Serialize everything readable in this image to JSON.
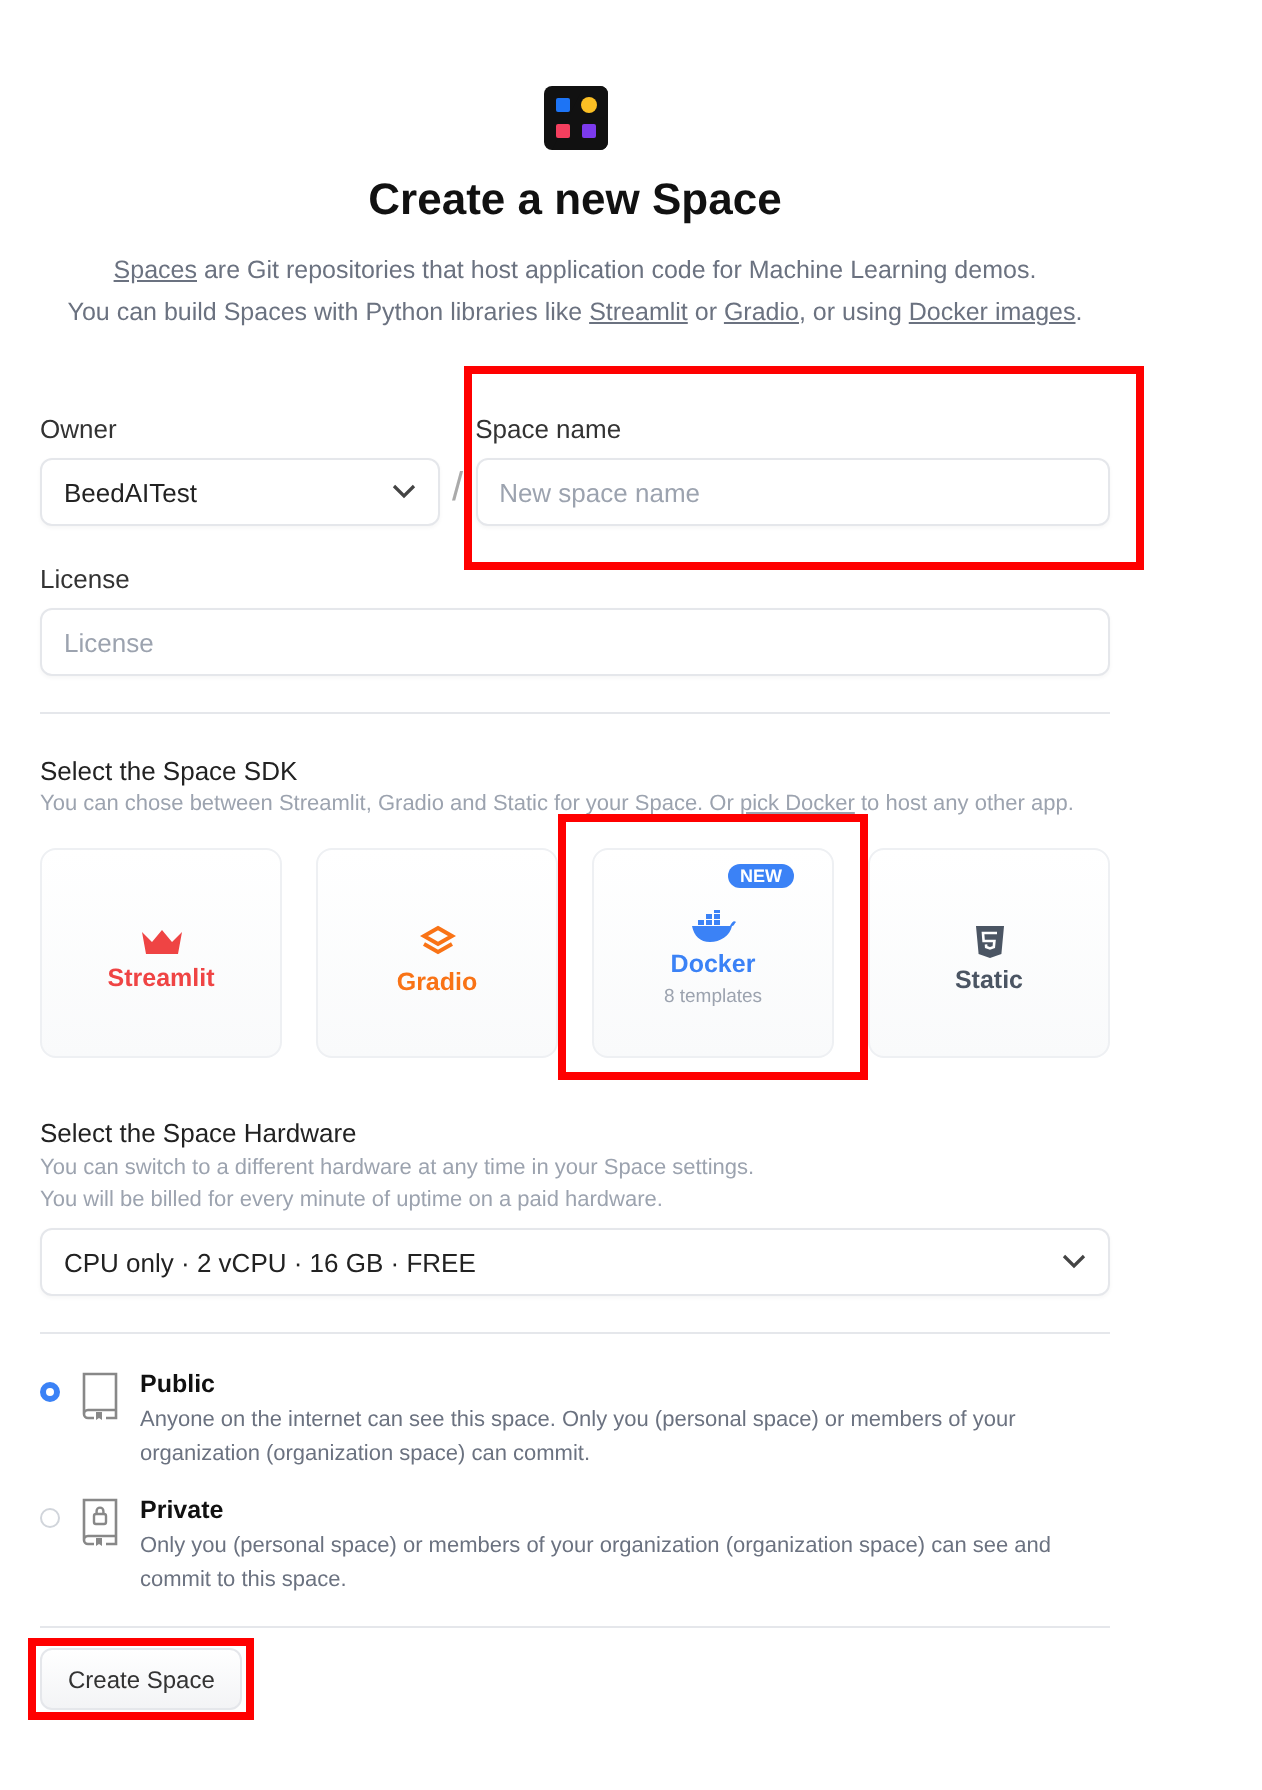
{
  "title": "Create a new Space",
  "intro": [
    [
      {
        "text": "Spaces",
        "link": true
      },
      {
        "text": " are Git repositories that host application code for Machine Learning demos.",
        "link": false
      }
    ],
    [
      {
        "text": "You can build Spaces with Python libraries like ",
        "link": false
      },
      {
        "text": "Streamlit",
        "link": true
      },
      {
        "text": " or ",
        "link": false
      },
      {
        "text": "Gradio",
        "link": true
      },
      {
        "text": ", or using ",
        "link": false
      },
      {
        "text": "Docker images",
        "link": true
      },
      {
        "text": ".",
        "link": false
      }
    ]
  ],
  "owner": {
    "label": "Owner",
    "value": "BeedAITest"
  },
  "separator": "/",
  "space_name": {
    "label": "Space name",
    "placeholder": "New space name",
    "highlighted": true
  },
  "license": {
    "label": "License",
    "placeholder": "License"
  },
  "sdk": {
    "title": "Select the Space SDK",
    "hint": [
      {
        "text": "You can chose between Streamlit, Gradio and Static for your Space. Or ",
        "link": false
      },
      {
        "text": "pick Docker",
        "link": true
      },
      {
        "text": " to host any other app.",
        "link": false
      }
    ],
    "options": [
      {
        "kind": "streamlit",
        "label": "Streamlit",
        "color": "#ef4444",
        "highlighted": false
      },
      {
        "kind": "gradio",
        "label": "Gradio",
        "color": "#f97316",
        "highlighted": false
      },
      {
        "kind": "docker",
        "label": "Docker",
        "color": "#3b82f6",
        "badge": "NEW",
        "sublabel": "8 templates",
        "highlighted": true
      },
      {
        "kind": "static",
        "label": "Static",
        "color": "#4b5563",
        "highlighted": false
      }
    ]
  },
  "hardware": {
    "title": "Select the Space Hardware",
    "hints": [
      "You can switch to a different hardware at any time in your Space settings.",
      "You will be billed for every minute of uptime on a paid hardware."
    ],
    "value": "CPU only · 2 vCPU · 16 GB · FREE"
  },
  "visibility": [
    {
      "kind": "public",
      "label": "Public",
      "description": "Anyone on the internet can see this space. Only you (personal space) or members of your organization (organization space) can commit.",
      "selected": true
    },
    {
      "kind": "private",
      "label": "Private",
      "description": "Only you (personal space) or members of your organization (organization space) can see and commit to this space.",
      "selected": false
    }
  ],
  "submit": {
    "label": "Create Space",
    "highlighted": true
  }
}
